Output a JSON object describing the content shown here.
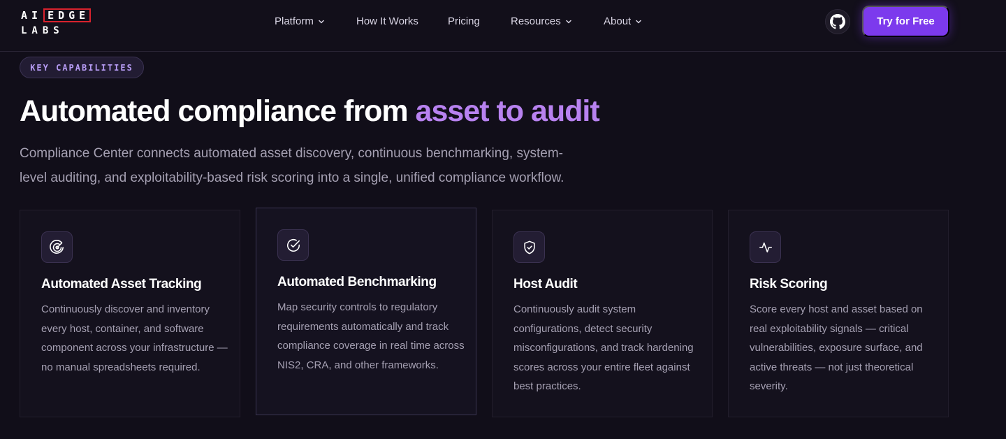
{
  "brand": {
    "logo_row1_prefix": "AI",
    "logo_row1_boxed": "EDGE",
    "logo_row2": "LABS",
    "accent_color": "#7c3aed",
    "logo_box_color": "#d8222d"
  },
  "nav": {
    "items": [
      {
        "label": "Platform",
        "dropdown": true
      },
      {
        "label": "How It Works",
        "dropdown": false
      },
      {
        "label": "Pricing",
        "dropdown": false
      },
      {
        "label": "Resources",
        "dropdown": true
      },
      {
        "label": "About",
        "dropdown": true
      }
    ],
    "github_icon": "github-icon",
    "cta_label": "Try for Free"
  },
  "hero": {
    "badge": "KEY CAPABILITIES",
    "headline_plain": "Automated compliance from ",
    "headline_accent": "asset to audit",
    "headline_accent_color": "#b882f0",
    "subtitle": "Compliance Center connects automated asset discovery, continuous benchmarking, system-level auditing, and exploitability-based risk scoring into a single, unified compliance workflow."
  },
  "cards": [
    {
      "icon": "radar-icon",
      "title": "Automated Asset Tracking",
      "body": "Continuously discover and inventory every host, container, and software component across your infrastructure — no manual spreadsheets required."
    },
    {
      "icon": "check-circle-icon",
      "title": "Automated Benchmarking",
      "body": "Map security controls to regulatory requirements automatically and track compliance coverage in real time across NIS2, CRA, and other frameworks."
    },
    {
      "icon": "shield-check-icon",
      "title": "Host Audit",
      "body": "Continuously audit system configurations, detect security misconfigurations, and track hardening scores across your entire fleet against best practices."
    },
    {
      "icon": "activity-icon",
      "title": "Risk Scoring",
      "body": "Score every host and asset based on real exploitability signals — critical vulnerabilities, exposure surface, and active threats — not just theoretical severity."
    }
  ]
}
